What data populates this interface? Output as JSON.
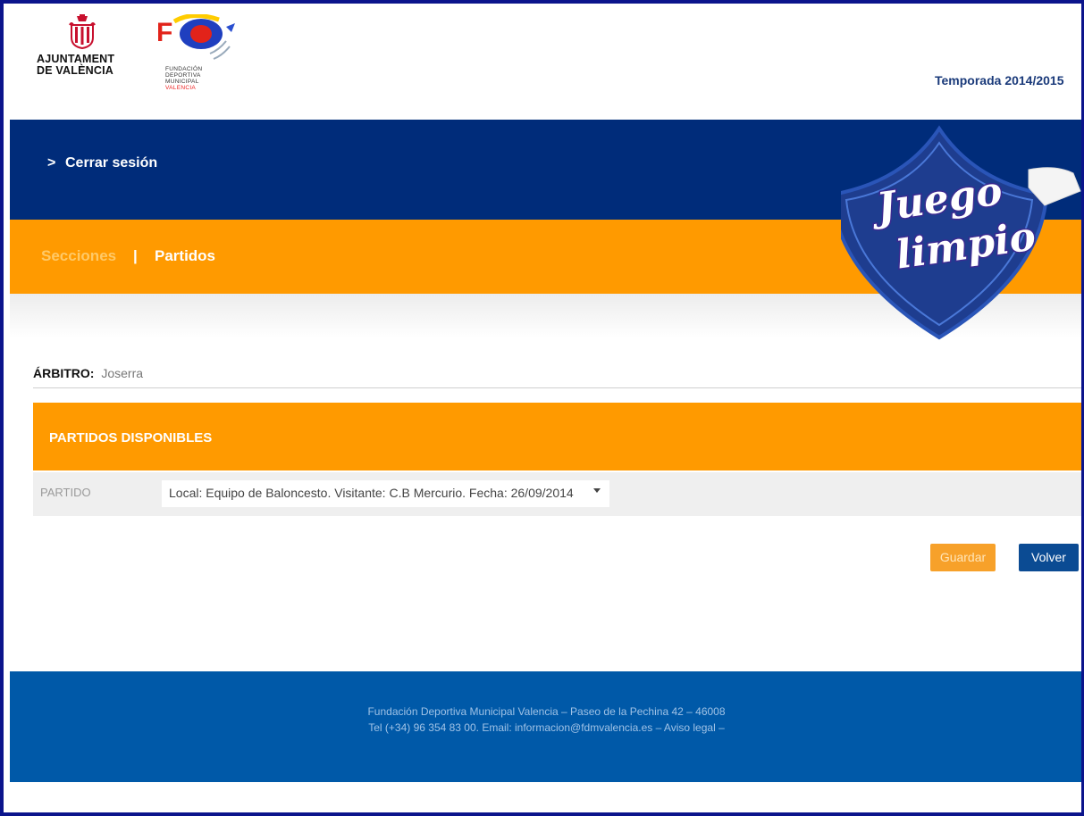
{
  "header": {
    "logo_ayuntamiento_line1": "AJUNTAMENT",
    "logo_ayuntamiento_line2": "DE VALÈNCIA",
    "logo_fdm_lines": [
      "FUNDACIÓN",
      "DEPORTIVA",
      "MUNICIPAL"
    ],
    "logo_fdm_city": "VALENCIA",
    "season": "Temporada 2014/2015"
  },
  "nav": {
    "logout_arrow": ">",
    "logout_label": "Cerrar sesión"
  },
  "menu": {
    "secciones": "Secciones",
    "separator": "|",
    "partidos": "Partidos"
  },
  "badge": {
    "line1": "Juego",
    "line2": "limpio"
  },
  "referee": {
    "label": "ÁRBITRO:",
    "name": "Joserra"
  },
  "panel": {
    "title": "PARTIDOS DISPONIBLES",
    "field_label": "PARTIDO",
    "selected_match": "Local: Equipo de Baloncesto. Visitante: C.B Mercurio. Fecha: 26/09/2014"
  },
  "buttons": {
    "save": "Guardar",
    "back": "Volver"
  },
  "footer": {
    "line1": "Fundación Deportiva Municipal Valencia – Paseo de la Pechina 42 – 46008",
    "line2": "Tel (+34) 96 354 83 00. Email: informacion@fdmvalencia.es – Aviso legal –"
  },
  "colors": {
    "nav_blue": "#002c7a",
    "orange": "#ff9a00",
    "footer_blue": "#0059a8",
    "button_blue": "#0b4b93"
  }
}
